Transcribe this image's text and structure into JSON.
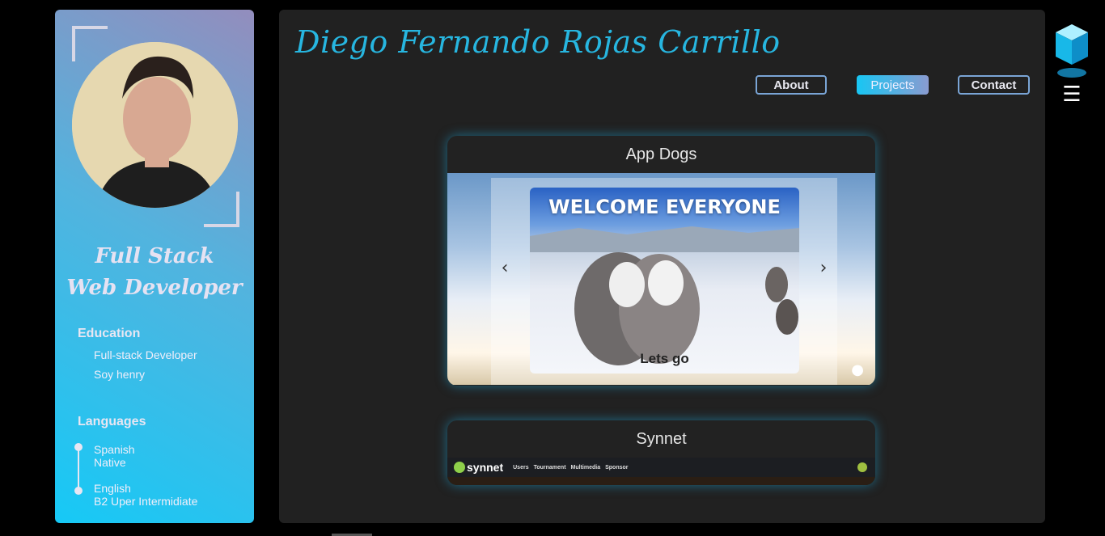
{
  "sidebar": {
    "role_line1": "Full Stack",
    "role_line2": "Web Developer",
    "education": {
      "title": "Education",
      "items": [
        "Full-stack Developer",
        "Soy henry"
      ]
    },
    "languages": {
      "title": "Languages",
      "items": [
        {
          "language": "Spanish",
          "level": "Native"
        },
        {
          "language": "English",
          "level": "B2 Uper Intermidiate"
        }
      ]
    }
  },
  "header": {
    "name": "Diego Fernando Rojas Carrillo",
    "nav": [
      "About",
      "Projects",
      "Contact"
    ],
    "active_nav": "Projects"
  },
  "projects": [
    {
      "title": "App Dogs",
      "preview": {
        "headline": "WELCOME EVERYONE",
        "cta": "Lets go"
      }
    },
    {
      "title": "Synnet",
      "preview": {
        "logo": "synnet",
        "links": [
          "Users",
          "Tournament",
          "Multimedia",
          "Sponsor"
        ]
      }
    }
  ],
  "colors": {
    "accent": "#27b6e0",
    "panel": "#212121",
    "background": "#000000"
  },
  "icons": [
    "cube-logo-icon",
    "hamburger-menu-icon",
    "chevron-left-icon",
    "chevron-right-icon",
    "paw-icon"
  ]
}
